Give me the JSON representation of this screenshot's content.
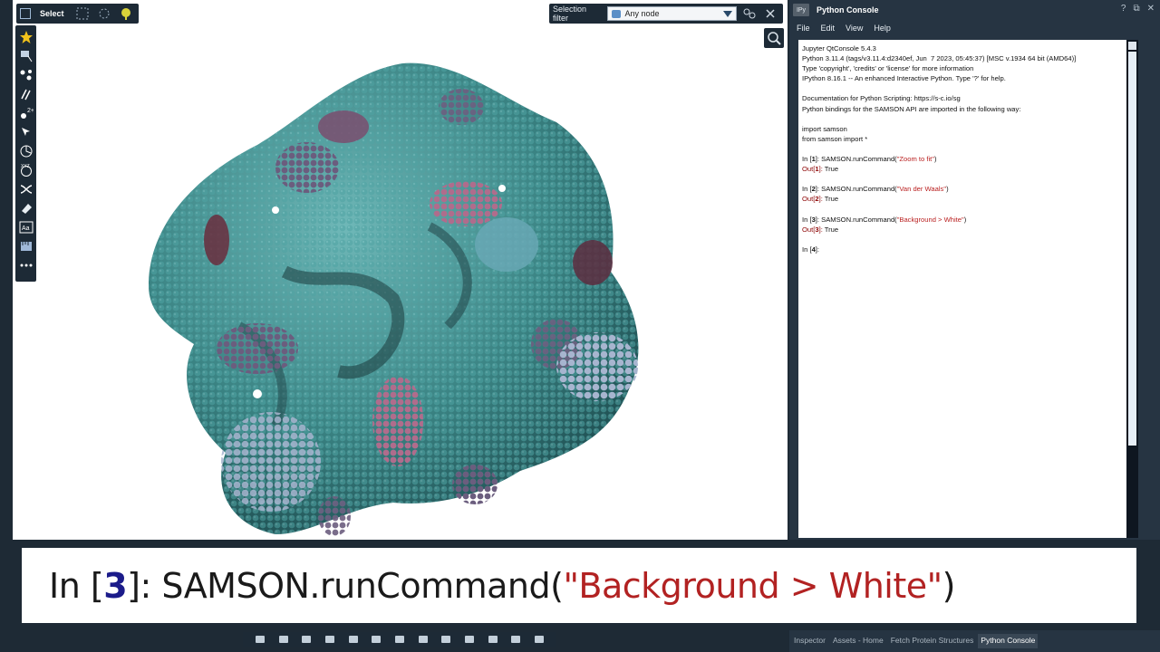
{
  "viewport": {
    "select_label": "Select",
    "selection_filter_label": "Selection filter",
    "selection_filter_value": "Any node"
  },
  "console": {
    "title": "Python Console",
    "menu": [
      "File",
      "Edit",
      "View",
      "Help"
    ],
    "header_lines": [
      "Jupyter QtConsole 5.4.3",
      "Python 3.11.4 (tags/v3.11.4:d2340ef, Jun  7 2023, 05:45:37) [MSC v.1934 64 bit (AMD64)]",
      "Type 'copyright', 'credits' or 'license' for more information",
      "IPython 8.16.1 -- An enhanced Interactive Python. Type '?' for help."
    ],
    "doc_lines": [
      "Documentation for Python Scripting: https://s-c.io/sg",
      "Python bindings for the SAMSON API are imported in the following way:"
    ],
    "import_lines": [
      "import samson",
      "from samson import *"
    ],
    "cells": [
      {
        "n": "1",
        "code_prefix": "SAMSON.runCommand(",
        "arg": "\"Zoom to fit\"",
        "code_suffix": ")",
        "out": "True"
      },
      {
        "n": "2",
        "code_prefix": "SAMSON.runCommand(",
        "arg": "\"Van der Waals\"",
        "code_suffix": ")",
        "out": "True"
      },
      {
        "n": "3",
        "code_prefix": "SAMSON.runCommand(",
        "arg": "\"Background > White\"",
        "code_suffix": ")",
        "out": "True"
      }
    ],
    "prompt_n": "4",
    "in_label": "In [",
    "out_label": "Out[",
    "bracket_close": "]: "
  },
  "tabs": [
    "Inspector",
    "Assets - Home",
    "Fetch Protein Structures",
    "Python Console"
  ],
  "active_tab": "Python Console",
  "banner": {
    "prefix": "In [",
    "n": "3",
    "mid": "]: SAMSON.runCommand(",
    "arg": "\"Background > White\"",
    "suffix": ")"
  },
  "colors": {
    "panel_bg": "#263442",
    "toolbar_bg": "#1d2a36",
    "molecule_main": "#3d8a8a",
    "molecule_accent_purple": "#7a6688",
    "molecule_accent_pink": "#b86a8a",
    "molecule_accent_blue": "#9fb0cc"
  }
}
